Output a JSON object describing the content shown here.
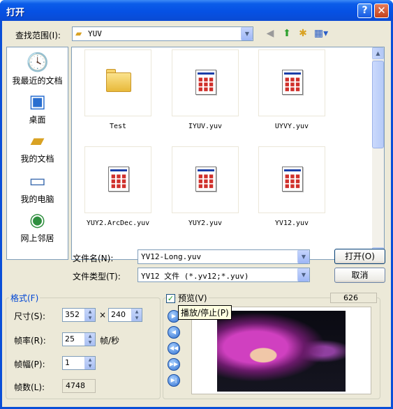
{
  "window": {
    "title": "打开",
    "help_icon": "help-icon",
    "close_icon": "close-icon"
  },
  "toolbar": {
    "look_in_label": "查找范围(I):",
    "look_in_value": "YUV",
    "icons": [
      "back-icon",
      "up-folder-icon",
      "new-folder-icon",
      "view-menu-icon"
    ]
  },
  "places": [
    {
      "label": "我最近的文档",
      "icon": "recent-documents-icon"
    },
    {
      "label": "桌面",
      "icon": "desktop-icon"
    },
    {
      "label": "我的文档",
      "icon": "my-documents-icon"
    },
    {
      "label": "我的电脑",
      "icon": "my-computer-icon"
    },
    {
      "label": "网上邻居",
      "icon": "network-places-icon"
    }
  ],
  "files": [
    {
      "name": "Test",
      "type": "folder"
    },
    {
      "name": "IYUV.yuv",
      "type": "file"
    },
    {
      "name": "UYVY.yuv",
      "type": "file"
    },
    {
      "name": "YUY2.ArcDec.yuv",
      "type": "file"
    },
    {
      "name": "YUY2.yuv",
      "type": "file"
    },
    {
      "name": "YV12.yuv",
      "type": "file"
    }
  ],
  "filename": {
    "label": "文件名(N):",
    "value": "YV12-Long.yuv"
  },
  "filetype": {
    "label": "文件类型(T):",
    "value": "YV12 文件 (*.yv12;*.yuv)"
  },
  "buttons": {
    "open": "打开(O)",
    "cancel": "取消"
  },
  "format": {
    "title": "格式(F)",
    "size_label": "尺寸(S):",
    "width": "352",
    "times": "×",
    "height": "240",
    "fps_label": "帧率(R):",
    "fps": "25",
    "fps_unit": "帧/秒",
    "frame_label": "帧幅(P):",
    "frame": "1",
    "count_label": "帧数(L):",
    "count": "4748"
  },
  "preview": {
    "title": "预览(V)",
    "checked": true,
    "frame_number": "626",
    "tooltip": "播放/停止(P)",
    "controls": [
      "play-stop-icon",
      "step-back-icon",
      "rewind-icon",
      "fast-forward-icon",
      "step-end-icon"
    ]
  },
  "colors": {
    "accent": "#0046d5",
    "titlebar": "#0651e4",
    "dialog": "#ece9d8"
  }
}
